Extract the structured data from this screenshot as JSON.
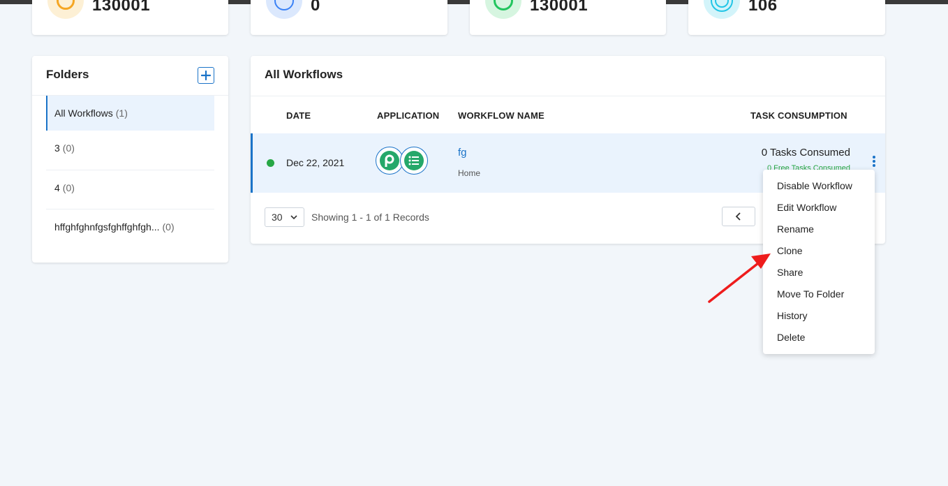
{
  "stats": [
    {
      "value": "130001",
      "icon": "gear-icon",
      "color": "#f5a623"
    },
    {
      "value": "0",
      "icon": "circle-icon",
      "color": "#3b82f6"
    },
    {
      "value": "130001",
      "icon": "check-icon",
      "color": "#22c55e"
    },
    {
      "value": "106",
      "icon": "spiral-icon",
      "color": "#22c5e6"
    }
  ],
  "folders": {
    "title": "Folders",
    "items": [
      {
        "name": "All Workflows",
        "count": "(1)"
      },
      {
        "name": "3",
        "count": "(0)"
      },
      {
        "name": "4",
        "count": "(0)"
      },
      {
        "name": "hffghfghnfgsfghffghfgh...",
        "count": "(0)"
      }
    ]
  },
  "workflows": {
    "title": "All Workflows",
    "columns": {
      "date": "DATE",
      "application": "APPLICATION",
      "name": "WORKFLOW NAME",
      "tasks": "TASK CONSUMPTION"
    },
    "rows": [
      {
        "date": "Dec 22, 2021",
        "name": "fg",
        "folder": "Home",
        "tasks": "0 Tasks Consumed",
        "free_tasks": "0 Free Tasks Consumed"
      }
    ],
    "per_page": "30",
    "records": "Showing 1 - 1 of 1 Records"
  },
  "menu": {
    "items": [
      "Disable Workflow",
      "Edit Workflow",
      "Rename",
      "Clone",
      "Share",
      "Move To Folder",
      "History",
      "Delete"
    ]
  },
  "colors": {
    "accent": "#1a73c8",
    "active_status": "#27a745",
    "annotation_arrow": "#ee1c1c"
  }
}
